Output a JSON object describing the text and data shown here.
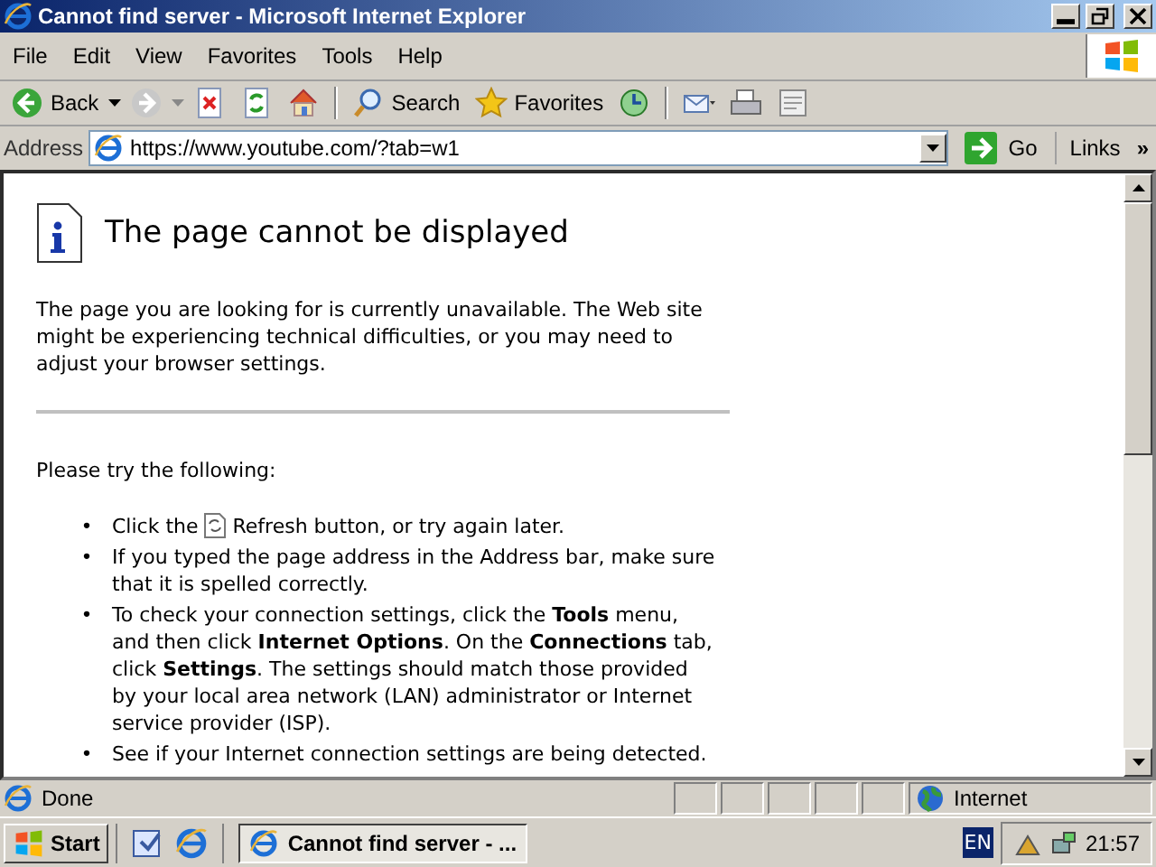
{
  "window": {
    "title": "Cannot find server - Microsoft Internet Explorer"
  },
  "menu": [
    "File",
    "Edit",
    "View",
    "Favorites",
    "Tools",
    "Help"
  ],
  "toolbar": [
    {
      "kind": "back",
      "label": "Back"
    },
    {
      "kind": "forward"
    },
    {
      "kind": "stop"
    },
    {
      "kind": "refresh"
    },
    {
      "kind": "home"
    },
    {
      "kind": "search",
      "label": "Search"
    },
    {
      "kind": "favorites",
      "label": "Favorites"
    },
    {
      "kind": "history"
    },
    {
      "kind": "mail"
    },
    {
      "kind": "print"
    },
    {
      "kind": "edit"
    }
  ],
  "address_bar": {
    "label": "Address",
    "value": "https://www.youtube.com/?tab=w1",
    "go": "Go",
    "links": "Links",
    "chevron": "»"
  },
  "page": {
    "heading": "The page cannot be displayed",
    "intro": "The page you are looking for is currently unavailable. The Web site might be experiencing technical difficulties, or you may need to adjust your browser settings.",
    "prompt": "Please try the following:",
    "bullet": "•",
    "tips": [
      {
        "lead": "Click the",
        "text": "Refresh button, or try again later."
      },
      {
        "text": "If you typed the page address in the Address bar, make sure that it is spelled correctly."
      },
      {
        "text": "To check your connection settings, click the **Tools** menu, and then click **Internet Options**. On the **Connections** tab, click **Settings**. The settings should match those provided by your local area network (LAN) administrator or Internet service provider (ISP)."
      },
      {
        "text": "See if your Internet connection settings are being detected."
      }
    ]
  },
  "status_bar": {
    "text": "Done",
    "zone": "Internet"
  },
  "taskbar": {
    "start": "Start",
    "tasks": [
      {
        "label": "Cannot find server - ...",
        "selected": true
      }
    ],
    "language": "EN",
    "clock": "21:57"
  }
}
